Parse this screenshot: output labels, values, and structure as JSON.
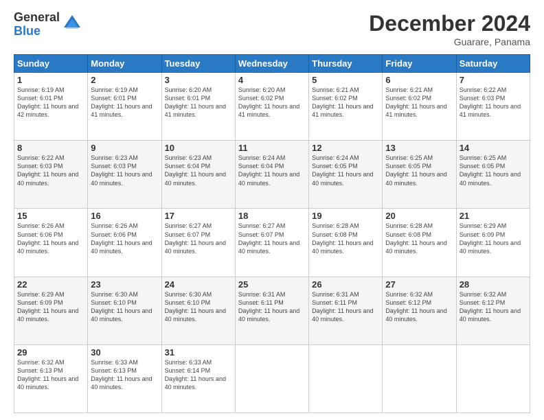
{
  "logo": {
    "general": "General",
    "blue": "Blue"
  },
  "header": {
    "month": "December 2024",
    "location": "Guarare, Panama"
  },
  "weekdays": [
    "Sunday",
    "Monday",
    "Tuesday",
    "Wednesday",
    "Thursday",
    "Friday",
    "Saturday"
  ],
  "weeks": [
    [
      {
        "day": "1",
        "sunrise": "6:19 AM",
        "sunset": "6:01 PM",
        "daylight": "11 hours and 42 minutes."
      },
      {
        "day": "2",
        "sunrise": "6:19 AM",
        "sunset": "6:01 PM",
        "daylight": "11 hours and 41 minutes."
      },
      {
        "day": "3",
        "sunrise": "6:20 AM",
        "sunset": "6:01 PM",
        "daylight": "11 hours and 41 minutes."
      },
      {
        "day": "4",
        "sunrise": "6:20 AM",
        "sunset": "6:02 PM",
        "daylight": "11 hours and 41 minutes."
      },
      {
        "day": "5",
        "sunrise": "6:21 AM",
        "sunset": "6:02 PM",
        "daylight": "11 hours and 41 minutes."
      },
      {
        "day": "6",
        "sunrise": "6:21 AM",
        "sunset": "6:02 PM",
        "daylight": "11 hours and 41 minutes."
      },
      {
        "day": "7",
        "sunrise": "6:22 AM",
        "sunset": "6:03 PM",
        "daylight": "11 hours and 41 minutes."
      }
    ],
    [
      {
        "day": "8",
        "sunrise": "6:22 AM",
        "sunset": "6:03 PM",
        "daylight": "11 hours and 40 minutes."
      },
      {
        "day": "9",
        "sunrise": "6:23 AM",
        "sunset": "6:03 PM",
        "daylight": "11 hours and 40 minutes."
      },
      {
        "day": "10",
        "sunrise": "6:23 AM",
        "sunset": "6:04 PM",
        "daylight": "11 hours and 40 minutes."
      },
      {
        "day": "11",
        "sunrise": "6:24 AM",
        "sunset": "6:04 PM",
        "daylight": "11 hours and 40 minutes."
      },
      {
        "day": "12",
        "sunrise": "6:24 AM",
        "sunset": "6:05 PM",
        "daylight": "11 hours and 40 minutes."
      },
      {
        "day": "13",
        "sunrise": "6:25 AM",
        "sunset": "6:05 PM",
        "daylight": "11 hours and 40 minutes."
      },
      {
        "day": "14",
        "sunrise": "6:25 AM",
        "sunset": "6:05 PM",
        "daylight": "11 hours and 40 minutes."
      }
    ],
    [
      {
        "day": "15",
        "sunrise": "6:26 AM",
        "sunset": "6:06 PM",
        "daylight": "11 hours and 40 minutes."
      },
      {
        "day": "16",
        "sunrise": "6:26 AM",
        "sunset": "6:06 PM",
        "daylight": "11 hours and 40 minutes."
      },
      {
        "day": "17",
        "sunrise": "6:27 AM",
        "sunset": "6:07 PM",
        "daylight": "11 hours and 40 minutes."
      },
      {
        "day": "18",
        "sunrise": "6:27 AM",
        "sunset": "6:07 PM",
        "daylight": "11 hours and 40 minutes."
      },
      {
        "day": "19",
        "sunrise": "6:28 AM",
        "sunset": "6:08 PM",
        "daylight": "11 hours and 40 minutes."
      },
      {
        "day": "20",
        "sunrise": "6:28 AM",
        "sunset": "6:08 PM",
        "daylight": "11 hours and 40 minutes."
      },
      {
        "day": "21",
        "sunrise": "6:29 AM",
        "sunset": "6:09 PM",
        "daylight": "11 hours and 40 minutes."
      }
    ],
    [
      {
        "day": "22",
        "sunrise": "6:29 AM",
        "sunset": "6:09 PM",
        "daylight": "11 hours and 40 minutes."
      },
      {
        "day": "23",
        "sunrise": "6:30 AM",
        "sunset": "6:10 PM",
        "daylight": "11 hours and 40 minutes."
      },
      {
        "day": "24",
        "sunrise": "6:30 AM",
        "sunset": "6:10 PM",
        "daylight": "11 hours and 40 minutes."
      },
      {
        "day": "25",
        "sunrise": "6:31 AM",
        "sunset": "6:11 PM",
        "daylight": "11 hours and 40 minutes."
      },
      {
        "day": "26",
        "sunrise": "6:31 AM",
        "sunset": "6:11 PM",
        "daylight": "11 hours and 40 minutes."
      },
      {
        "day": "27",
        "sunrise": "6:32 AM",
        "sunset": "6:12 PM",
        "daylight": "11 hours and 40 minutes."
      },
      {
        "day": "28",
        "sunrise": "6:32 AM",
        "sunset": "6:12 PM",
        "daylight": "11 hours and 40 minutes."
      }
    ],
    [
      {
        "day": "29",
        "sunrise": "6:32 AM",
        "sunset": "6:13 PM",
        "daylight": "11 hours and 40 minutes."
      },
      {
        "day": "30",
        "sunrise": "6:33 AM",
        "sunset": "6:13 PM",
        "daylight": "11 hours and 40 minutes."
      },
      {
        "day": "31",
        "sunrise": "6:33 AM",
        "sunset": "6:14 PM",
        "daylight": "11 hours and 40 minutes."
      },
      null,
      null,
      null,
      null
    ]
  ]
}
